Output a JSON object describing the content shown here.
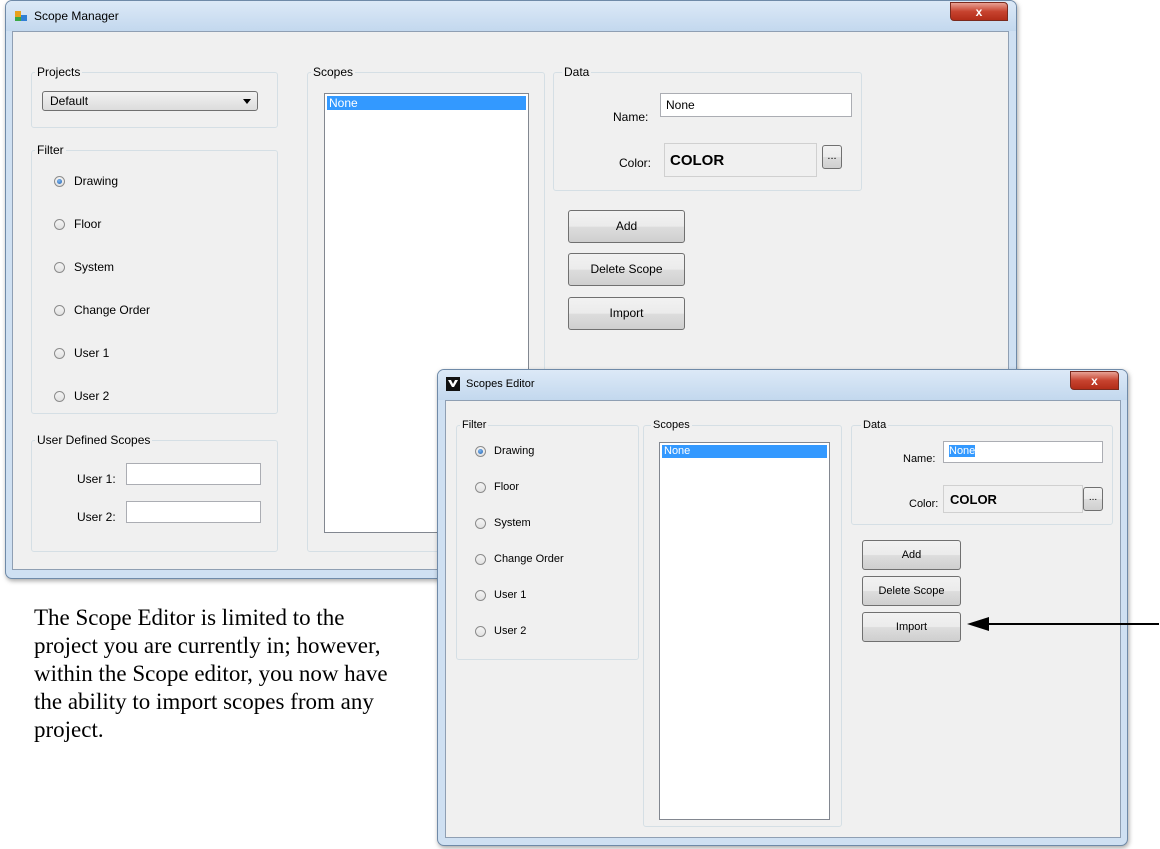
{
  "scope_manager": {
    "title": "Scope Manager",
    "close": "x",
    "projects": {
      "label": "Projects",
      "selected": "Default"
    },
    "filter": {
      "label": "Filter",
      "options": [
        "Drawing",
        "Floor",
        "System",
        "Change Order",
        "User 1",
        "User 2"
      ],
      "selected": "Drawing"
    },
    "user_defined": {
      "label": "User Defined Scopes",
      "user1_label": "User 1:",
      "user1_value": "",
      "user2_label": "User 2:",
      "user2_value": ""
    },
    "scopes": {
      "label": "Scopes",
      "items": [
        "None"
      ]
    },
    "data": {
      "label": "Data",
      "name_label": "Name:",
      "name_value": "None",
      "color_label": "Color:",
      "color_value": "COLOR",
      "browse_label": "..."
    },
    "buttons": {
      "add": "Add",
      "delete": "Delete Scope",
      "import": "Import"
    }
  },
  "scopes_editor": {
    "title": "Scopes Editor",
    "close": "x",
    "filter": {
      "label": "Filter",
      "options": [
        "Drawing",
        "Floor",
        "System",
        "Change Order",
        "User 1",
        "User 2"
      ],
      "selected": "Drawing"
    },
    "scopes": {
      "label": "Scopes",
      "items": [
        "None"
      ]
    },
    "data": {
      "label": "Data",
      "name_label": "Name:",
      "name_value": "None",
      "color_label": "Color:",
      "color_value": "COLOR",
      "browse_label": "..."
    },
    "buttons": {
      "add": "Add",
      "delete": "Delete Scope",
      "import": "Import"
    }
  },
  "caption": "The Scope Editor is limited to the project you are currently in; however, within the Scope editor, you now have the ability to import scopes from any project.",
  "colors": {
    "selection": "#3399ff",
    "window_bg": "#f0f0f0",
    "frame": "#cfe0f2",
    "close_button": "#c7432f"
  }
}
